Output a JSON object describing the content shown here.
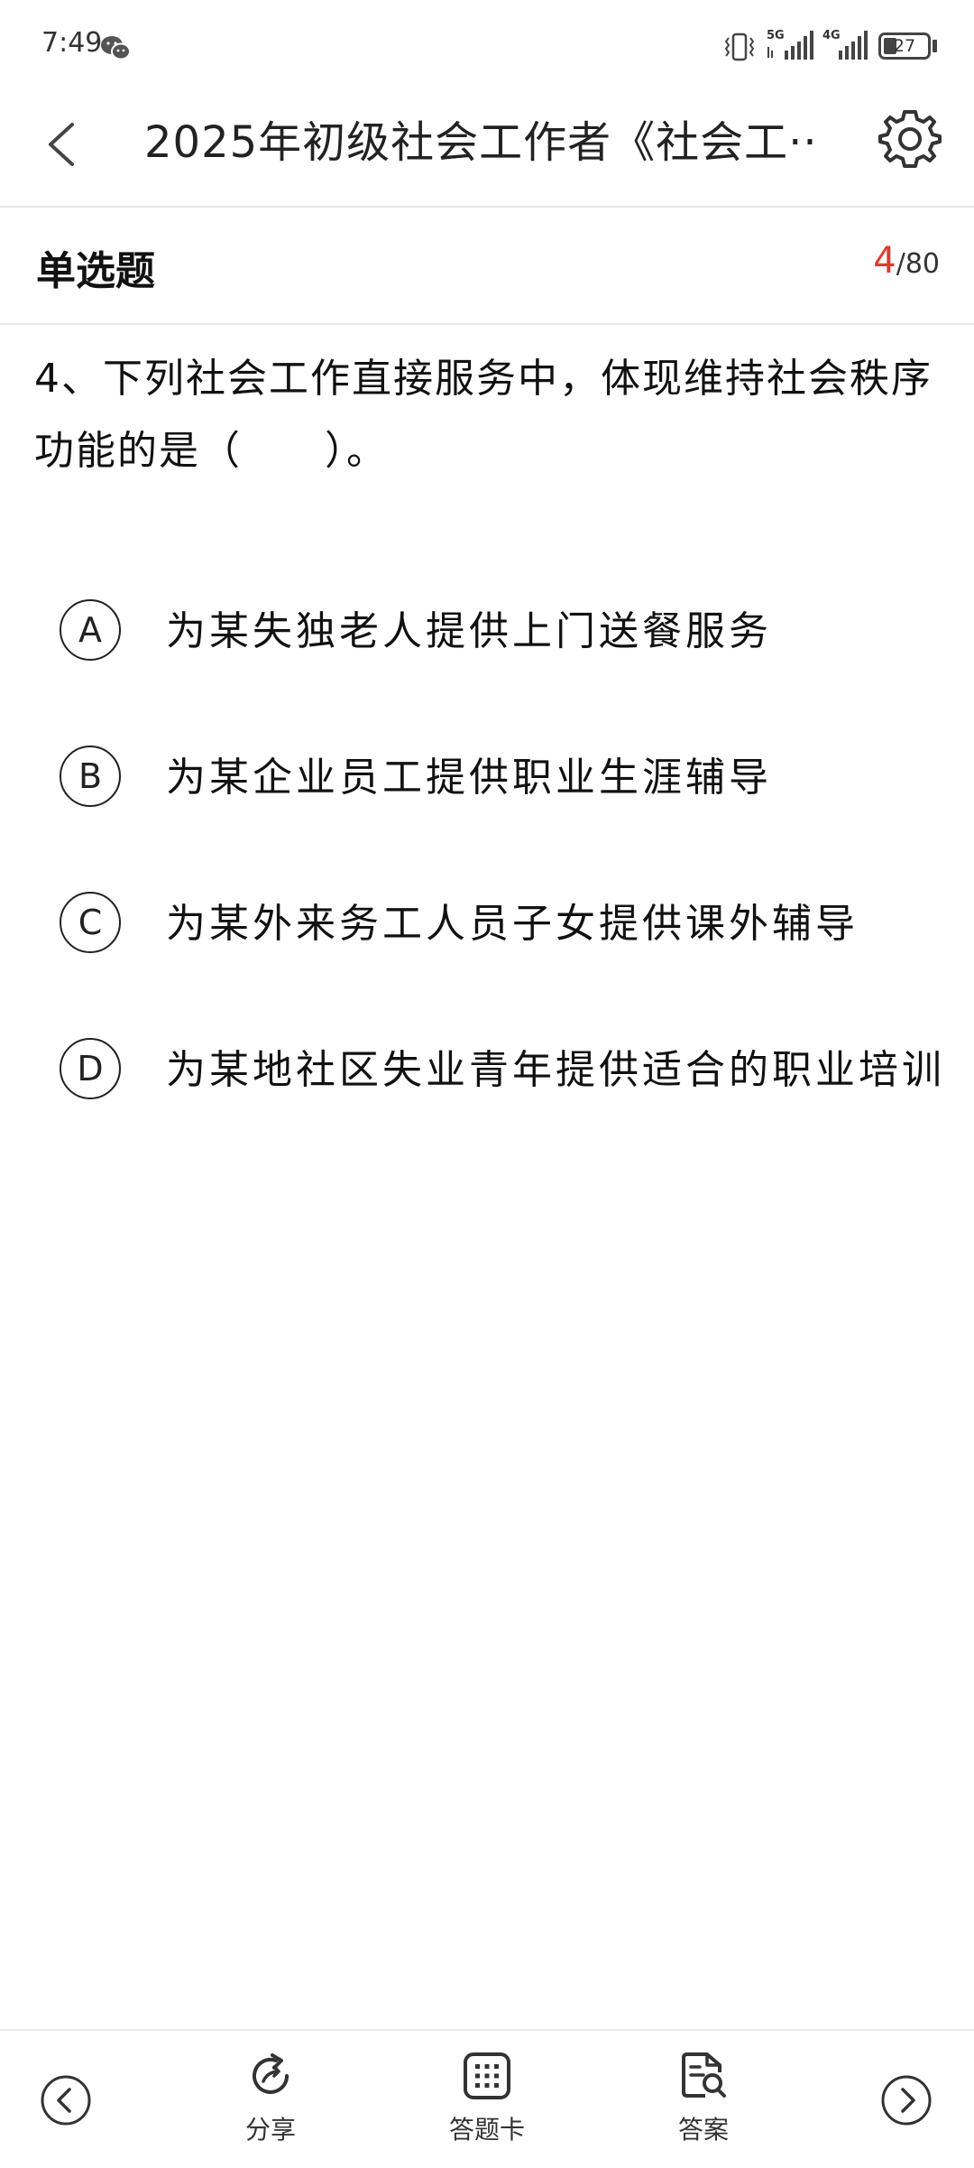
{
  "status_bar": {
    "time": "7:49",
    "net1": "5G",
    "net2": "4G",
    "battery": "27"
  },
  "header": {
    "title": "2025年初级社会工作者《社会工··"
  },
  "question_type": {
    "label": "单选题",
    "current": "4",
    "total": "/80"
  },
  "question": {
    "text": "4、下列社会工作直接服务中，体现维持社会秩序功能的是（　　）。"
  },
  "options": [
    {
      "letter": "A",
      "text": "为某失独老人提供上门送餐服务"
    },
    {
      "letter": "B",
      "text": "为某企业员工提供职业生涯辅导"
    },
    {
      "letter": "C",
      "text": "为某外来务工人员子女提供课外辅导"
    },
    {
      "letter": "D",
      "text": "为某地社区失业青年提供适合的职业培训"
    }
  ],
  "bottom_bar": {
    "share": "分享",
    "answer_card": "答题卡",
    "answer": "答案"
  },
  "icons": {
    "back": "chevron-left-icon",
    "settings": "gear-icon",
    "prev": "circle-chevron-left-icon",
    "next": "circle-chevron-right-icon",
    "share": "share-refresh-icon",
    "answer_card": "grid-icon",
    "answer": "document-search-icon"
  }
}
